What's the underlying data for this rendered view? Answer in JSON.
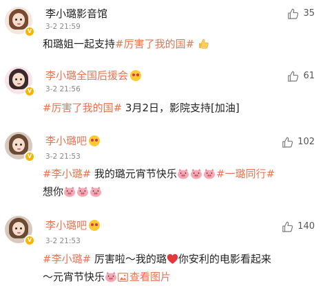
{
  "comments": [
    {
      "name": "李小璐影音馆",
      "time": "3-2 21:59",
      "likes": "35",
      "text": [
        "和璐姐一起支持",
        "#厉害了我的国#"
      ]
    },
    {
      "name": "李小璐全国后援会",
      "time": "3-2 21:56",
      "likes": "61",
      "text": [
        "#厉害了我的国#",
        " 3月2日，影院支持[加油]"
      ]
    },
    {
      "name": "李小璐吧",
      "time": "3-2 21:53",
      "likes": "102",
      "text": [
        "#李小璐#",
        " 我的璐元宵节快乐",
        "#一璐同行#",
        "想你"
      ]
    },
    {
      "name": "李小璐吧",
      "time": "3-2 21:53",
      "likes": "140",
      "text": [
        "#李小璐#",
        " 厉害啦～我的璐",
        "你安利的电影看起来",
        "～元宵节快乐",
        "查看图片"
      ]
    }
  ],
  "icons": {
    "like": "thumbs-up-icon",
    "verified": "verified-badge-icon",
    "image": "image-icon"
  },
  "colors": {
    "accent": "#eb7350",
    "verified": "#f8b400",
    "text": "#222222",
    "meta": "#888888"
  }
}
